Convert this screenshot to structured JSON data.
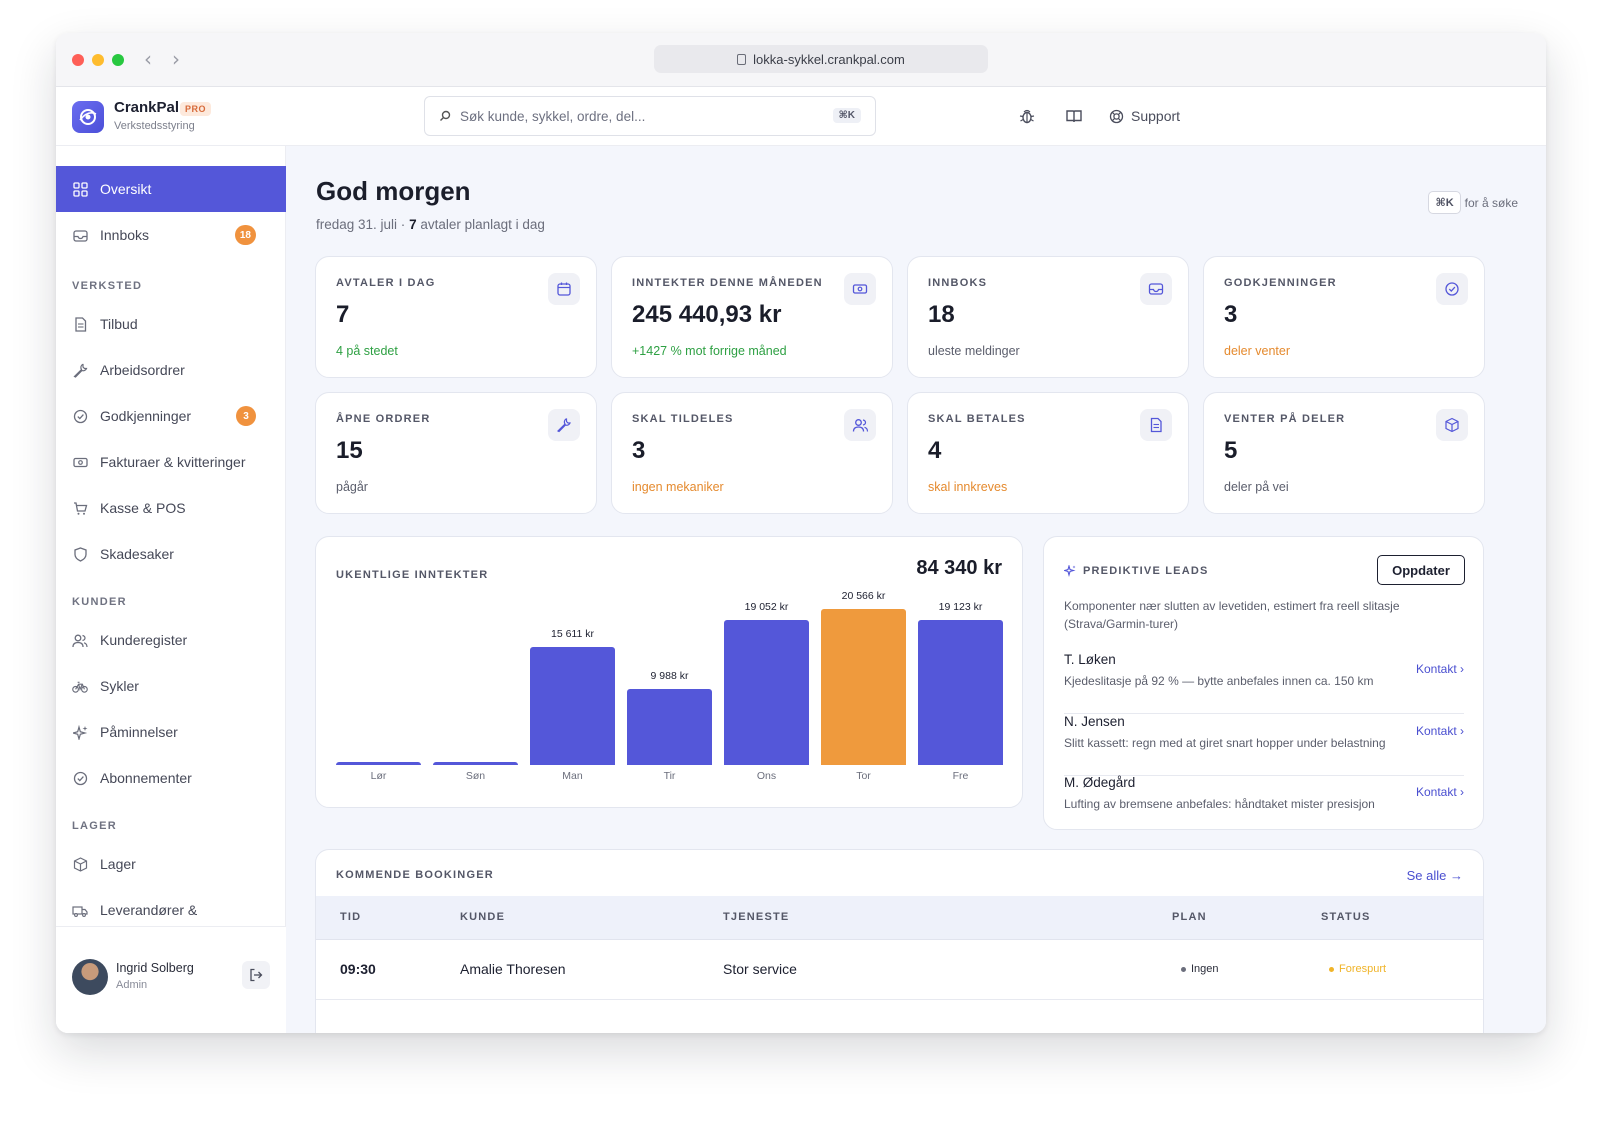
{
  "browser": {
    "url": "lokka-sykkel.crankpal.com"
  },
  "app": {
    "name": "CrankPal",
    "tier": "PRO",
    "subtitle": "Verkstedsstyring"
  },
  "search": {
    "placeholder": "Søk kunde, sykkel, ordre, del...",
    "shortcut": "⌘K"
  },
  "header": {
    "support_label": "Support",
    "icons": [
      "bug-icon",
      "book-icon",
      "lifebuoy-icon"
    ]
  },
  "sidebar": {
    "top_items": [
      {
        "label": "Oversikt",
        "icon": "grid-icon",
        "active": true
      },
      {
        "label": "Innboks",
        "icon": "inbox-icon",
        "badge": "18"
      }
    ],
    "sections": [
      {
        "title": "VERKSTED",
        "items": [
          {
            "label": "Tilbud",
            "icon": "document-icon"
          },
          {
            "label": "Arbeidsordrer",
            "icon": "wrench-icon"
          },
          {
            "label": "Godkjenninger",
            "icon": "check-circle-icon",
            "badge": "3"
          },
          {
            "label": "Fakturaer & kvitteringer",
            "icon": "banknote-icon"
          },
          {
            "label": "Kasse & POS",
            "icon": "cart-icon"
          },
          {
            "label": "Skadesaker",
            "icon": "shield-icon"
          }
        ]
      },
      {
        "title": "KUNDER",
        "items": [
          {
            "label": "Kunderegister",
            "icon": "users-icon"
          },
          {
            "label": "Sykler",
            "icon": "bike-icon"
          },
          {
            "label": "Påminnelser",
            "icon": "sparkle-icon"
          },
          {
            "label": "Abonnementer",
            "icon": "check-circle-icon"
          }
        ]
      },
      {
        "title": "LAGER",
        "items": [
          {
            "label": "Lager",
            "icon": "box-icon"
          },
          {
            "label": "Leverandører &",
            "icon": "truck-icon"
          }
        ]
      }
    ],
    "user": {
      "name": "Ingrid Solberg",
      "role": "Admin"
    }
  },
  "main": {
    "greeting": "God morgen",
    "date_text": "fredag 31. juli · ",
    "appointments_count": "7",
    "appointments_suffix": " avtaler planlagt i dag",
    "search_hint_key": "⌘K",
    "search_hint_text": "for å søke"
  },
  "kpis": [
    {
      "label": "AVTALER I DAG",
      "value": "7",
      "note": "4 på stedet",
      "tone": "green",
      "icon": "calendar-icon"
    },
    {
      "label": "INNTEKTER DENNE MÅNEDEN",
      "value": "245 440,93 kr",
      "note": "+1427 % mot forrige måned",
      "tone": "green",
      "icon": "banknote-icon"
    },
    {
      "label": "INNBOKS",
      "value": "18",
      "note": "uleste meldinger",
      "tone": "gray",
      "icon": "inbox-icon"
    },
    {
      "label": "GODKJENNINGER",
      "value": "3",
      "note": "deler venter",
      "tone": "orange",
      "icon": "check-circle-icon"
    },
    {
      "label": "ÅPNE ORDRER",
      "value": "15",
      "note": "pågår",
      "tone": "gray",
      "icon": "wrench-icon"
    },
    {
      "label": "SKAL TILDELES",
      "value": "3",
      "note": "ingen mekaniker",
      "tone": "orange",
      "icon": "users-icon"
    },
    {
      "label": "SKAL BETALES",
      "value": "4",
      "note": "skal innkreves",
      "tone": "orange",
      "icon": "document-icon"
    },
    {
      "label": "VENTER PÅ DELER",
      "value": "5",
      "note": "deler på vei",
      "tone": "gray",
      "icon": "box-icon"
    }
  ],
  "chart_data": {
    "type": "bar",
    "title": "UKENTLIGE INNTEKTER",
    "total": "84 340 kr",
    "categories": [
      "Lør",
      "Søn",
      "Man",
      "Tir",
      "Ons",
      "Tor",
      "Fre"
    ],
    "values": [
      0,
      0,
      15611,
      9988,
      19052,
      20566,
      19123
    ],
    "value_labels": [
      "",
      "",
      "15 611 kr",
      "9 988 kr",
      "19 052 kr",
      "20 566 kr",
      "19 123 kr"
    ],
    "highlight_index": 5,
    "ylim": [
      0,
      20566
    ],
    "grid": false,
    "colors": {
      "bar": "#5457d9",
      "highlight": "#ef9a3d"
    }
  },
  "leads": {
    "title": "PREDIKTIVE LEADS",
    "refresh_label": "Oppdater",
    "description": "Komponenter nær slutten av levetiden, estimert fra reell slitasje (Strava/Garmin-turer)",
    "items": [
      {
        "name": "T. Løken",
        "desc": "Kjedeslitasje på 92 % — bytte anbefales innen ca. 150 km",
        "action": "Kontakt ›"
      },
      {
        "name": "N. Jensen",
        "desc": "Slitt kassett: regn med at giret snart hopper under belastning",
        "action": "Kontakt ›"
      },
      {
        "name": "M. Ødegård",
        "desc": "Lufting av bremsene anbefales: håndtaket mister presisjon",
        "action": "Kontakt ›"
      }
    ]
  },
  "bookings": {
    "title": "KOMMENDE BOOKINGER",
    "see_all": "Se alle →",
    "columns": [
      "TID",
      "KUNDE",
      "TJENESTE",
      "PLAN",
      "STATUS"
    ],
    "rows": [
      {
        "time": "09:30",
        "customer": "Amalie Thoresen",
        "service": "Stor service",
        "plan": "Ingen",
        "status": "Forespurt"
      }
    ],
    "colors": {
      "plan_dot": "#6b6e7c",
      "status": "#f0b429"
    }
  }
}
